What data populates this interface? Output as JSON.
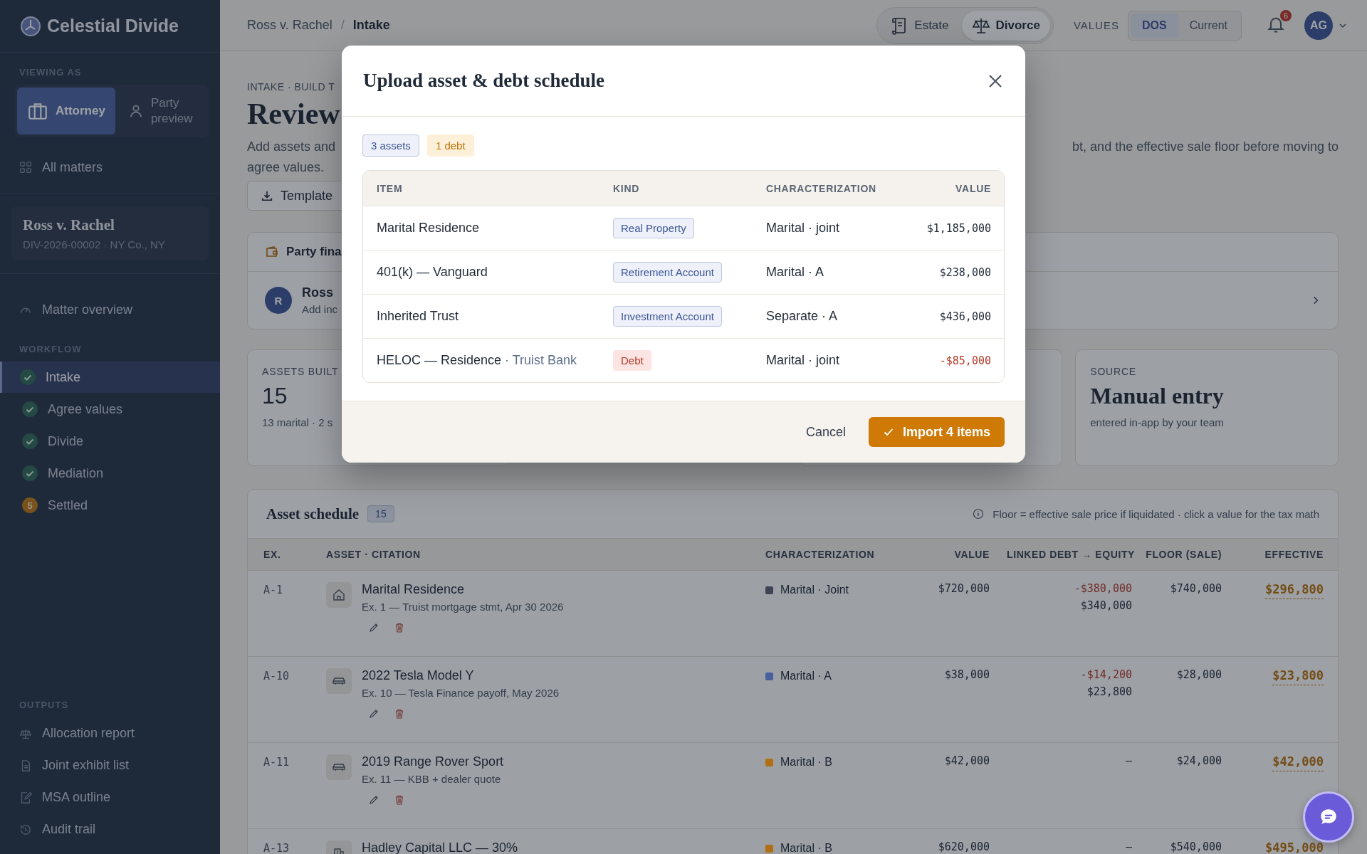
{
  "brand": {
    "name": "Celestial Divide"
  },
  "sidebar": {
    "viewing_label": "VIEWING AS",
    "roles": [
      {
        "label": "Attorney",
        "selected": true
      },
      {
        "label": "Party preview",
        "selected": false
      }
    ],
    "all_matters": "All matters",
    "matter": {
      "title": "Ross v. Rachel",
      "subtitle": "DIV-2026-00002 · NY Co., NY"
    },
    "overview": "Matter overview",
    "workflow_label": "WORKFLOW",
    "workflow": [
      {
        "label": "Intake",
        "kind": "done",
        "selected": true
      },
      {
        "label": "Agree values",
        "kind": "done",
        "selected": false
      },
      {
        "label": "Divide",
        "kind": "done",
        "selected": false
      },
      {
        "label": "Mediation",
        "kind": "done",
        "selected": false
      },
      {
        "label": "Settled",
        "kind": "count",
        "badge": "5",
        "selected": false
      }
    ],
    "outputs_label": "OUTPUTS",
    "outputs": [
      {
        "label": "Allocation report"
      },
      {
        "label": "Joint exhibit list"
      },
      {
        "label": "MSA outline"
      },
      {
        "label": "Audit trail"
      }
    ]
  },
  "topbar": {
    "breadcrumb": [
      "Ross v. Rachel",
      "Intake"
    ],
    "breadcrumb_separator": "/",
    "modes": [
      {
        "label": "Estate",
        "selected": false
      },
      {
        "label": "Divorce",
        "selected": true
      }
    ],
    "values_label": "VALUES",
    "values": [
      {
        "label": "DOS",
        "selected": true
      },
      {
        "label": "Current",
        "selected": false
      }
    ],
    "notifications": "6",
    "avatar": "AG"
  },
  "page": {
    "eyebrow": "INTAKE · BUILD T",
    "title": "Review",
    "description_left": "Add assets and",
    "description_right": "bt, and the effective sale floor before moving to",
    "description_line2": "agree values.",
    "template_button": "Template",
    "party_card": {
      "title": "Party fina",
      "avatar": "R",
      "name": "Ross",
      "hint": "Add inc"
    },
    "stats": [
      {
        "label": "ASSETS BUILT",
        "value": "15",
        "note": "13 marital · 2 s"
      },
      {
        "label": "SOURCE",
        "value": "Manual entry",
        "note": "entered in-app by your team"
      }
    ]
  },
  "schedule": {
    "title": "Asset schedule",
    "count": "15",
    "note": "Floor = effective sale price if liquidated · click a value for the tax math",
    "columns": [
      "EX.",
      "ASSET · CITATION",
      "CHARACTERIZATION",
      "VALUE",
      "LINKED DEBT → EQUITY",
      "FLOOR (SALE)",
      "EFFECTIVE"
    ],
    "rows": [
      {
        "ex": "A-1",
        "name": "Marital Residence",
        "citation": "Ex. 1 — Truist mortgage stmt, Apr 30 2026",
        "characterization": "Marital · Joint",
        "color": "#3e4455",
        "value": "$720,000",
        "debt": "-$380,000",
        "equity": "$340,000",
        "floor": "$740,000",
        "effective": "$296,800"
      },
      {
        "ex": "A-10",
        "name": "2022 Tesla Model Y",
        "citation": "Ex. 10 — Tesla Finance payoff, May 2026",
        "characterization": "Marital · A",
        "color": "#48609c",
        "value": "$38,000",
        "debt": "-$14,200",
        "equity": "$23,800",
        "floor": "$28,000",
        "effective": "$23,800"
      },
      {
        "ex": "A-11",
        "name": "2019 Range Rover Sport",
        "citation": "Ex. 11 — KBB + dealer quote",
        "characterization": "Marital · B",
        "color": "#b06f14",
        "value": "$42,000",
        "equity": "—",
        "floor": "$24,000",
        "effective": "$42,000"
      },
      {
        "ex": "A-13",
        "name": "Hadley Capital LLC — 30%",
        "characterization": "Marital · B",
        "color": "#b06f14",
        "value": "$620,000",
        "equity": "—",
        "floor": "$540,000",
        "effective": "$495,000"
      }
    ]
  },
  "modal": {
    "title": "Upload asset & debt schedule",
    "counts": [
      {
        "label": "3 assets",
        "kind": "asset"
      },
      {
        "label": "1 debt",
        "kind": "debt"
      }
    ],
    "columns": [
      "ITEM",
      "KIND",
      "CHARACTERIZATION",
      "VALUE"
    ],
    "rows": [
      {
        "item": "Marital Residence",
        "tag": "Real Property",
        "kind": "asset",
        "characterization": "Marital · joint",
        "value": "$1,185,000"
      },
      {
        "item": "401(k) — Vanguard",
        "tag": "Retirement Account",
        "kind": "asset",
        "characterization": "Marital · A",
        "value": "$238,000"
      },
      {
        "item": "Inherited Trust",
        "tag": "Investment Account",
        "kind": "asset",
        "characterization": "Separate · A",
        "value": "$436,000"
      },
      {
        "item": "HELOC — Residence",
        "lender": "· Truist Bank",
        "tag": "Debt",
        "kind": "debt",
        "characterization": "Marital · joint",
        "value": "-$85,000"
      }
    ],
    "cancel": "Cancel",
    "import": "Import 4 items"
  }
}
